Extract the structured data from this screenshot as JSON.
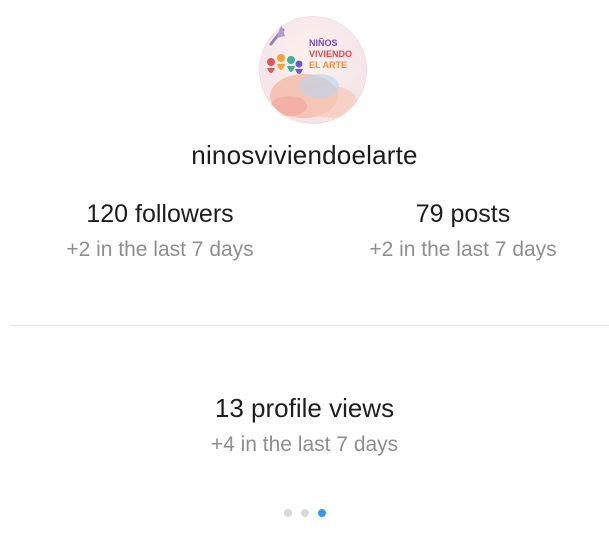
{
  "profile": {
    "username": "ninosviviendoelarte",
    "logo_text": [
      "NIÑOS",
      "VIVIENDO",
      "EL ARTE"
    ]
  },
  "stats": {
    "followers": {
      "label": "120 followers",
      "change": "+2 in the last 7 days"
    },
    "posts": {
      "label": "79 posts",
      "change": "+2 in the last 7 days"
    },
    "profile_views": {
      "label": "13 profile views",
      "change": "+4 in the last 7 days"
    }
  },
  "pager": {
    "total": 3,
    "active_index": 2,
    "active_color": "#3897f0",
    "inactive_color": "#d7d7d7"
  }
}
